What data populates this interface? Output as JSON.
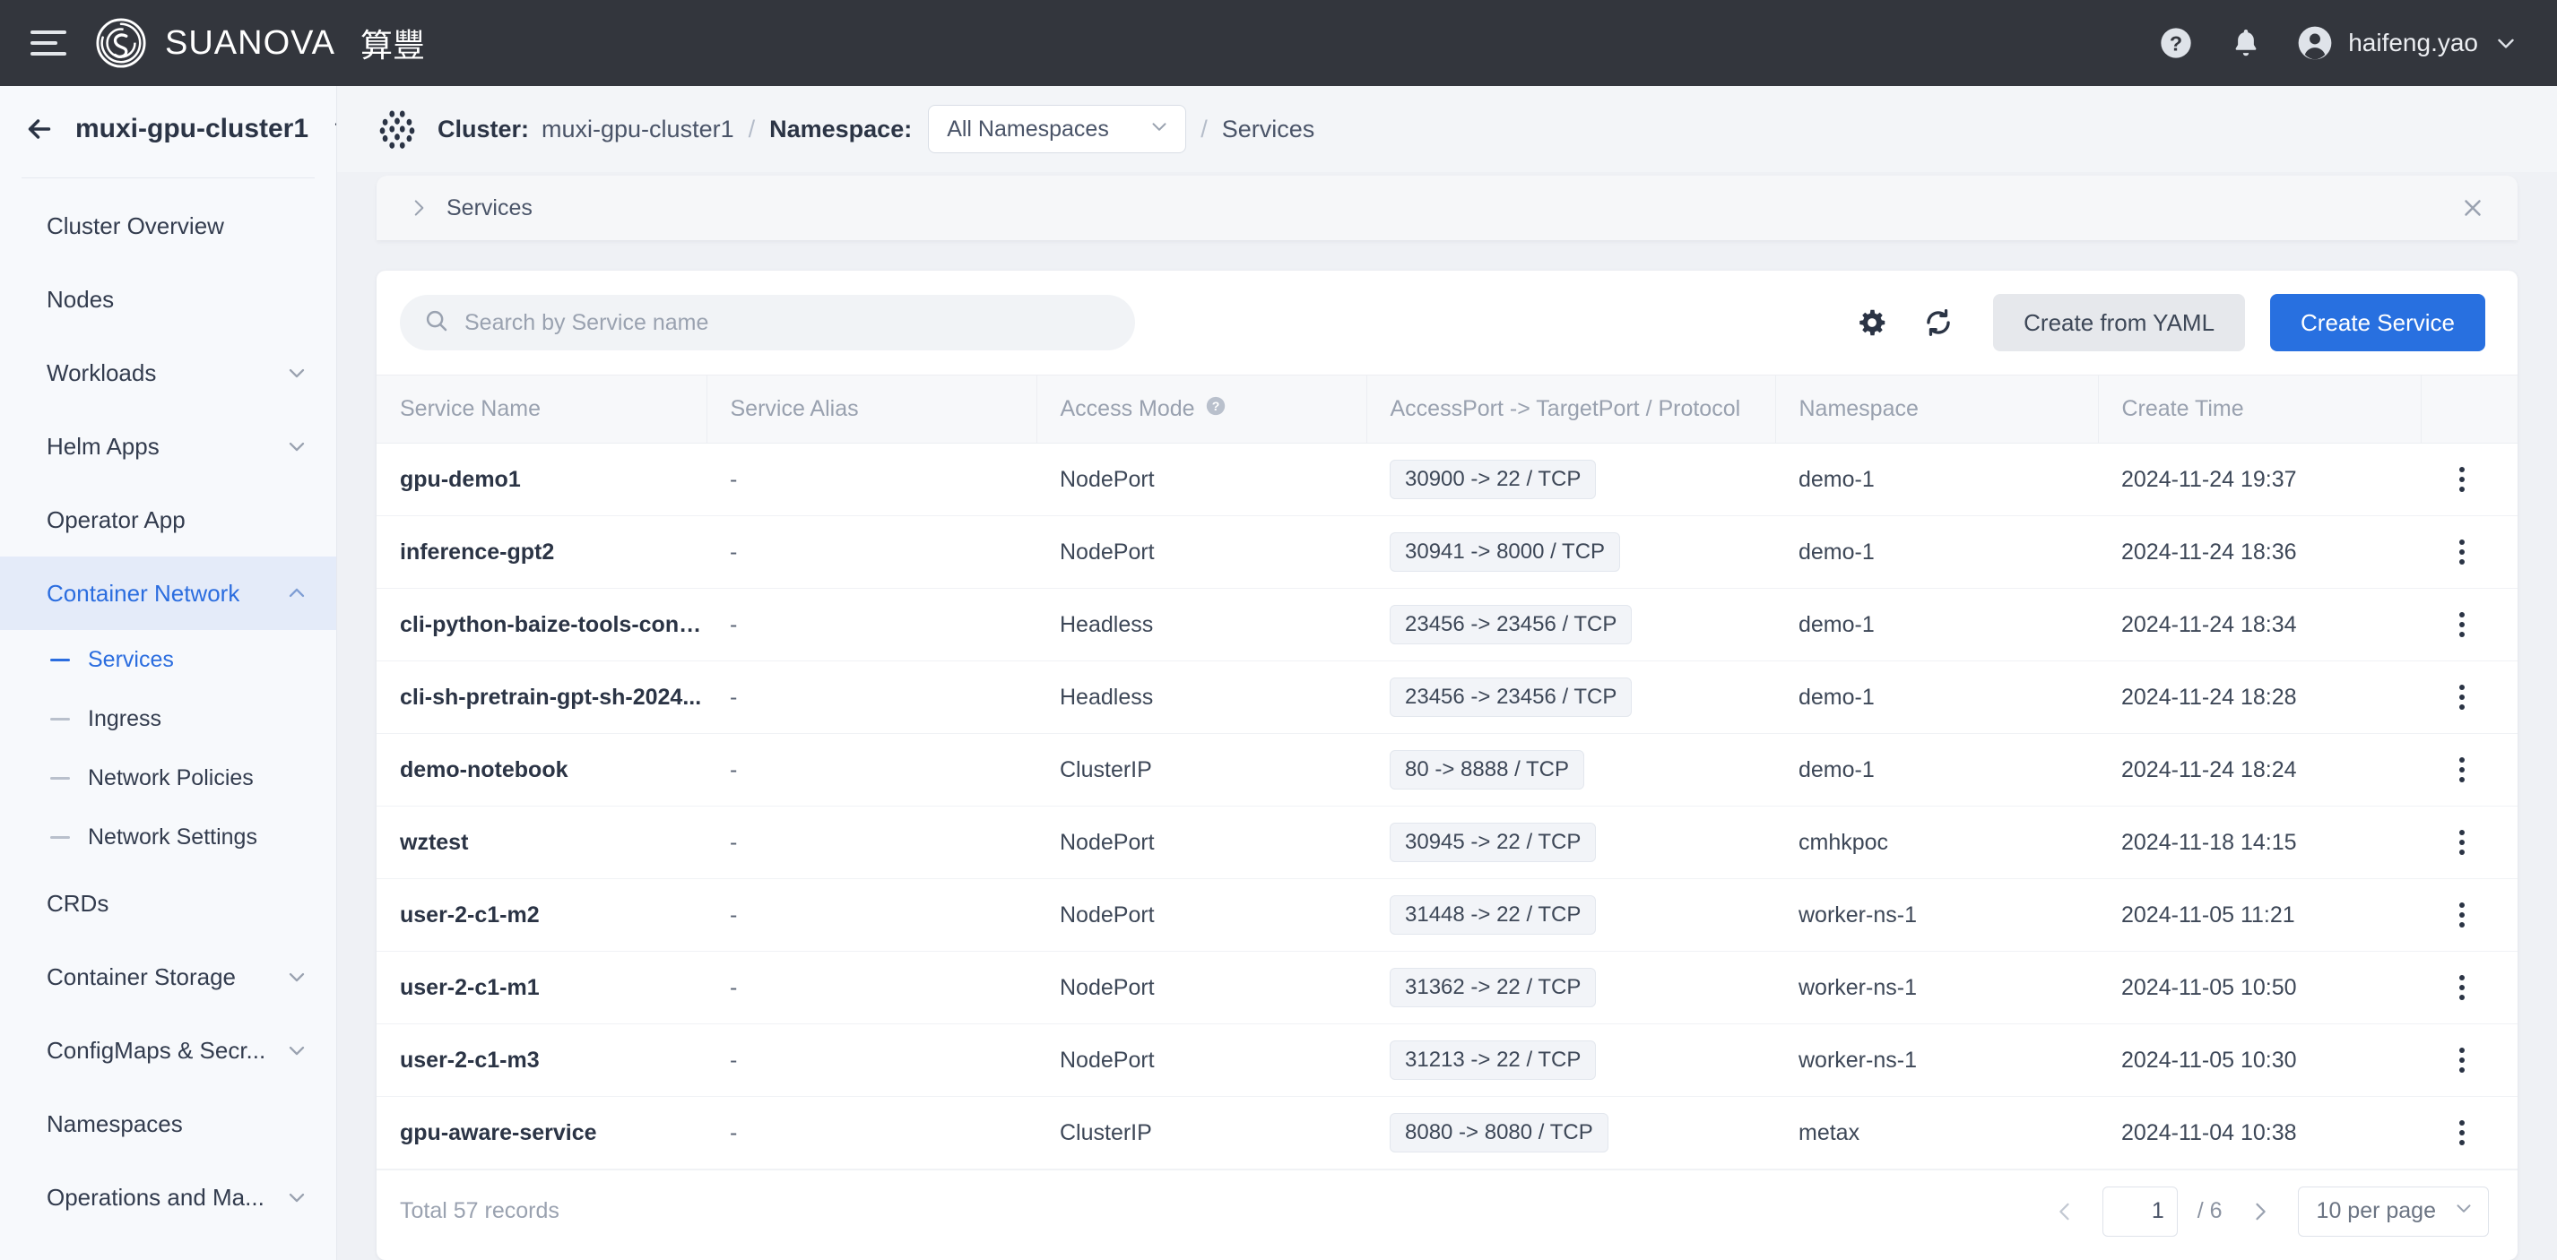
{
  "topbar": {
    "menu_icon": "hamburger-icon",
    "brand_name": "SUANOVA",
    "brand_cn": "算豐",
    "help_icon": "help-circle-icon",
    "bell_icon": "bell-icon",
    "user_name": "haifeng.yao",
    "user_caret": "chevron-down-icon"
  },
  "sidebar": {
    "back_icon": "arrow-left-icon",
    "cluster_name": "muxi-gpu-cluster1",
    "swap_icon": "swap-icon",
    "items": [
      {
        "label": "Cluster Overview",
        "expandable": false,
        "active": false
      },
      {
        "label": "Nodes",
        "expandable": false,
        "active": false
      },
      {
        "label": "Workloads",
        "expandable": true,
        "active": false
      },
      {
        "label": "Helm Apps",
        "expandable": true,
        "active": false
      },
      {
        "label": "Operator App",
        "expandable": false,
        "active": false
      },
      {
        "label": "Container Network",
        "expandable": true,
        "active": true
      },
      {
        "label": "CRDs",
        "expandable": false,
        "active": false
      },
      {
        "label": "Container Storage",
        "expandable": true,
        "active": false
      },
      {
        "label": "ConfigMaps & Secr...",
        "expandable": true,
        "active": false
      },
      {
        "label": "Namespaces",
        "expandable": false,
        "active": false
      },
      {
        "label": "Operations and Ma...",
        "expandable": true,
        "active": false
      }
    ],
    "subitems": [
      {
        "label": "Services",
        "active": true
      },
      {
        "label": "Ingress",
        "active": false
      },
      {
        "label": "Network Policies",
        "active": false
      },
      {
        "label": "Network Settings",
        "active": false
      }
    ]
  },
  "breadcrumb": {
    "cluster_icon": "kubernetes-dots-icon",
    "cluster_label": "Cluster:",
    "cluster_value": "muxi-gpu-cluster1",
    "separator": "/",
    "namespace_label": "Namespace:",
    "namespace_value": "All Namespaces",
    "namespace_caret": "chevron-down-icon",
    "page": "Services"
  },
  "tabstrip": {
    "expand_icon": "chevron-right-icon",
    "label": "Services",
    "close_icon": "close-icon"
  },
  "toolbar": {
    "search_icon": "search-icon",
    "search_placeholder": "Search by Service name",
    "search_value": "",
    "settings_icon": "gear-icon",
    "refresh_icon": "refresh-icon",
    "create_yaml_label": "Create from YAML",
    "create_service_label": "Create Service"
  },
  "table": {
    "columns": [
      "Service Name",
      "Service Alias",
      "Access Mode",
      "AccessPort -> TargetPort / Protocol",
      "Namespace",
      "Create Time"
    ],
    "access_mode_help_icon": "help-circle-icon",
    "row_menu_icon": "kebab-menu-icon",
    "rows": [
      {
        "name": "gpu-demo1",
        "alias": "-",
        "mode": "NodePort",
        "port": "30900 -> 22 / TCP",
        "namespace": "demo-1",
        "created": "2024-11-24 19:37"
      },
      {
        "name": "inference-gpt2",
        "alias": "-",
        "mode": "NodePort",
        "port": "30941 -> 8000 / TCP",
        "namespace": "demo-1",
        "created": "2024-11-24 18:36"
      },
      {
        "name": "cli-python-baize-tools-conv...",
        "alias": "-",
        "mode": "Headless",
        "port": "23456 -> 23456 / TCP",
        "namespace": "demo-1",
        "created": "2024-11-24 18:34"
      },
      {
        "name": "cli-sh-pretrain-gpt-sh-2024...",
        "alias": "-",
        "mode": "Headless",
        "port": "23456 -> 23456 / TCP",
        "namespace": "demo-1",
        "created": "2024-11-24 18:28"
      },
      {
        "name": "demo-notebook",
        "alias": "-",
        "mode": "ClusterIP",
        "port": "80 -> 8888 / TCP",
        "namespace": "demo-1",
        "created": "2024-11-24 18:24"
      },
      {
        "name": "wztest",
        "alias": "-",
        "mode": "NodePort",
        "port": "30945 -> 22 / TCP",
        "namespace": "cmhkpoc",
        "created": "2024-11-18 14:15"
      },
      {
        "name": "user-2-c1-m2",
        "alias": "-",
        "mode": "NodePort",
        "port": "31448 -> 22 / TCP",
        "namespace": "worker-ns-1",
        "created": "2024-11-05 11:21"
      },
      {
        "name": "user-2-c1-m1",
        "alias": "-",
        "mode": "NodePort",
        "port": "31362 -> 22 / TCP",
        "namespace": "worker-ns-1",
        "created": "2024-11-05 10:50"
      },
      {
        "name": "user-2-c1-m3",
        "alias": "-",
        "mode": "NodePort",
        "port": "31213 -> 22 / TCP",
        "namespace": "worker-ns-1",
        "created": "2024-11-05 10:30"
      },
      {
        "name": "gpu-aware-service",
        "alias": "-",
        "mode": "ClusterIP",
        "port": "8080 -> 8080 / TCP",
        "namespace": "metax",
        "created": "2024-11-04 10:38"
      }
    ]
  },
  "footer": {
    "total_text": "Total 57 records",
    "prev_icon": "chevron-left-icon",
    "current_page": "1",
    "page_of": "/ 6",
    "next_icon": "chevron-right-icon",
    "page_size": "10 per page",
    "page_size_caret": "chevron-down-icon"
  },
  "colors": {
    "accent_blue": "#2870e0",
    "topbar_bg": "#33363d",
    "active_nav_bg": "#e4ebf9",
    "page_bg": "#eff1f5"
  }
}
